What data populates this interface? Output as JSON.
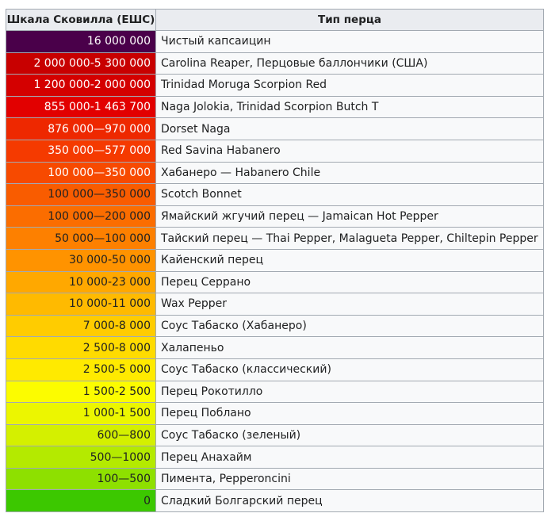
{
  "table": {
    "headers": [
      "Шкала Сковилла (ЕШС)",
      "Тип перца"
    ],
    "rows": [
      {
        "scale": "16 000 000",
        "type": "Чистый капсаицин",
        "color": "#4a004a",
        "text_color": "#ffffff"
      },
      {
        "scale": "2 000 000-5 300 000",
        "type": "Carolina Reaper, Перцовые баллончики (США)",
        "color": "#c80000",
        "text_color": "#ffffff"
      },
      {
        "scale": "1 200 000-2 000 000",
        "type": "Trinidad Moruga Scorpion Red",
        "color": "#d40000",
        "text_color": "#ffffff"
      },
      {
        "scale": "855 000-1 463 700",
        "type": "Naga Jolokia, Trinidad Scorpion Butch T",
        "color": "#e20000",
        "text_color": "#ffffff"
      },
      {
        "scale": "876 000—970 000",
        "type": "Dorset Naga",
        "color": "#ee2800",
        "text_color": "#ffffff"
      },
      {
        "scale": "350 000—577 000",
        "type": "Red Savina Habanero",
        "color": "#f53a00",
        "text_color": "#ffffff"
      },
      {
        "scale": "100 000—350 000",
        "type": "Хабанеро — Habanero Chile",
        "color": "#f74a00",
        "text_color": "#ffffff"
      },
      {
        "scale": "100 000—350 000",
        "type": "Scotch Bonnet",
        "color": "#f95c00",
        "text_color": "#202122"
      },
      {
        "scale": "100 000—200 000",
        "type": "Ямайский жгучий перец — Jamaican Hot Pepper",
        "color": "#fb6d00",
        "text_color": "#202122"
      },
      {
        "scale": "50 000—100 000",
        "type": "Тайский перец — Thai Pepper, Malagueta Pepper, Chiltepin Pepper",
        "color": "#fd8000",
        "text_color": "#202122"
      },
      {
        "scale": "30 000-50 000",
        "type": "Кайенский перец",
        "color": "#ff9300",
        "text_color": "#202122"
      },
      {
        "scale": "10 000-23 000",
        "type": "Перец Серрано",
        "color": "#ffa800",
        "text_color": "#202122"
      },
      {
        "scale": "10 000-11 000",
        "type": "Wax Pepper",
        "color": "#ffba00",
        "text_color": "#202122"
      },
      {
        "scale": "7 000-8 000",
        "type": "Соус Табаско (Хабанеро)",
        "color": "#ffcc00",
        "text_color": "#202122"
      },
      {
        "scale": "2 500-8 000",
        "type": "Халапеньо",
        "color": "#ffdb00",
        "text_color": "#202122"
      },
      {
        "scale": "2 500-5 000",
        "type": "Соус Табаско (классический)",
        "color": "#ffea00",
        "text_color": "#202122"
      },
      {
        "scale": "1 500-2 500",
        "type": "Перец Рокотилло",
        "color": "#fcfc00",
        "text_color": "#202122"
      },
      {
        "scale": "1 000-1 500",
        "type": "Перец Поблано",
        "color": "#ecf600",
        "text_color": "#202122"
      },
      {
        "scale": "600—800",
        "type": "Соус Табаско (зеленый)",
        "color": "#d4f000",
        "text_color": "#202122"
      },
      {
        "scale": "500—1000",
        "type": "Перец Анахайм",
        "color": "#b4ea00",
        "text_color": "#202122"
      },
      {
        "scale": "100—500",
        "type": "Пимента, Pepperoncini",
        "color": "#8ee000",
        "text_color": "#202122"
      },
      {
        "scale": "0",
        "type": "Сладкий Болгарский перец",
        "color": "#3cc800",
        "text_color": "#202122"
      }
    ]
  }
}
